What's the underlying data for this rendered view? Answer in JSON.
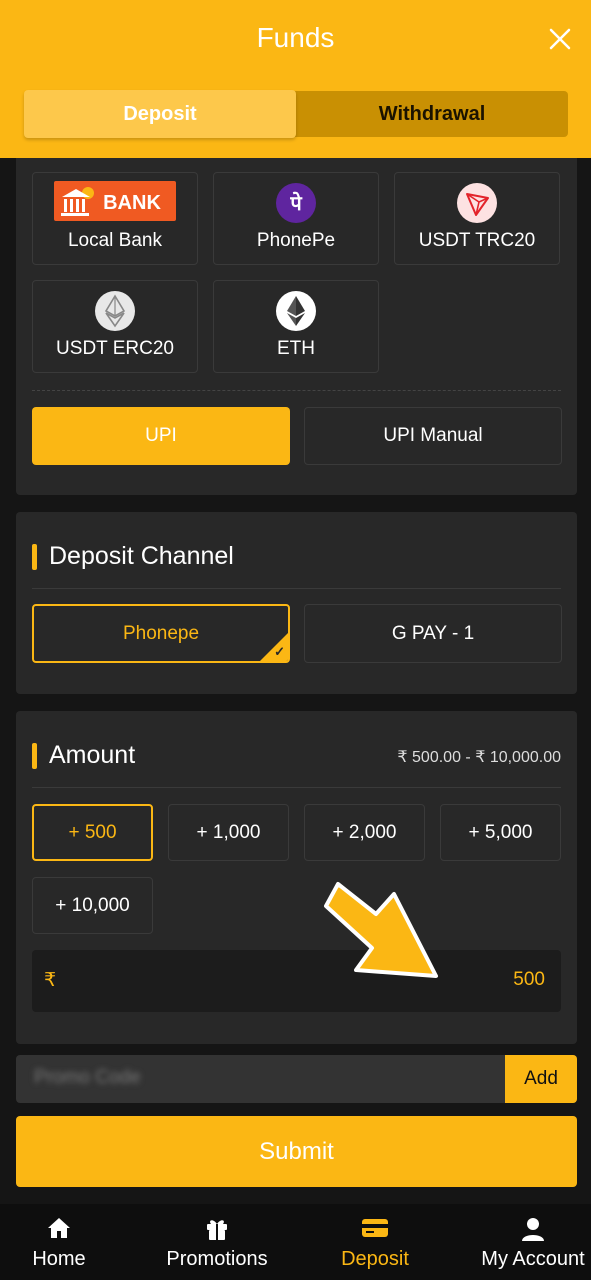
{
  "header": {
    "title": "Funds",
    "close_icon": "close-icon",
    "tabs": [
      {
        "label": "Deposit",
        "active": true
      },
      {
        "label": "Withdrawal",
        "active": false
      }
    ]
  },
  "methods": {
    "items": [
      {
        "label": "Local Bank",
        "icon": "bank-logo",
        "logo_text": "BANK"
      },
      {
        "label": "PhonePe",
        "icon": "phonepe-icon"
      },
      {
        "label": "USDT TRC20",
        "icon": "tron-icon"
      },
      {
        "label": "USDT ERC20",
        "icon": "ethereum-gray-icon"
      },
      {
        "label": "ETH",
        "icon": "ethereum-icon"
      }
    ],
    "options": [
      {
        "label": "UPI",
        "selected": true
      },
      {
        "label": "UPI Manual",
        "selected": false
      }
    ]
  },
  "channel": {
    "title": "Deposit Channel",
    "items": [
      {
        "label": "Phonepe",
        "selected": true
      },
      {
        "label": "G PAY - 1",
        "selected": false
      }
    ]
  },
  "amount": {
    "title": "Amount",
    "range": "₹ 500.00 - ₹ 10,000.00",
    "chips": [
      "+ 500",
      "+ 1,000",
      "+ 2,000",
      "+ 5,000",
      "+ 10,000"
    ],
    "selected_chip": "+ 500",
    "currency": "₹",
    "value": "500"
  },
  "promo": {
    "placeholder": "Promo Code",
    "add_label": "Add"
  },
  "submit_label": "Submit",
  "nav": [
    {
      "label": "Home",
      "icon": "home-icon",
      "active": false
    },
    {
      "label": "Promotions",
      "icon": "gift-icon",
      "active": false
    },
    {
      "label": "Deposit",
      "icon": "card-icon",
      "active": true
    },
    {
      "label": "My Account",
      "icon": "user-icon",
      "active": false
    }
  ],
  "colors": {
    "accent": "#fbb714",
    "card": "#282828",
    "background": "#151515"
  }
}
